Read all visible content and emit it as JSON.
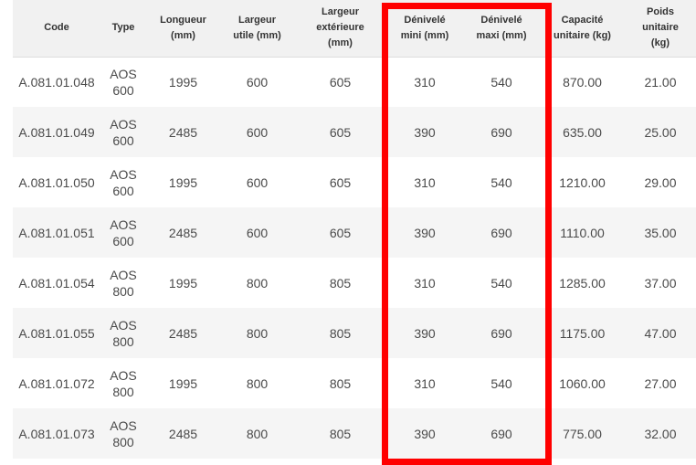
{
  "table": {
    "headers": [
      [
        "Code"
      ],
      [
        "Type"
      ],
      [
        "Longueur",
        "(mm)"
      ],
      [
        "Largeur",
        "utile (mm)"
      ],
      [
        "Largeur",
        "extérieure",
        "(mm)"
      ],
      [
        "Dénivelé",
        "mini (mm)"
      ],
      [
        "Dénivelé",
        "maxi (mm)"
      ],
      [
        "Capacité",
        "unitaire (kg)"
      ],
      [
        "Poids",
        "unitaire",
        "(kg)"
      ]
    ],
    "rows": [
      {
        "code": "A.081.01.048",
        "type": [
          "AOS",
          "600"
        ],
        "longueur": "1995",
        "largeur_utile": "600",
        "largeur_ext": "605",
        "den_mini": "310",
        "den_maxi": "540",
        "capacite": "870.00",
        "poids": "21.00"
      },
      {
        "code": "A.081.01.049",
        "type": [
          "AOS",
          "600"
        ],
        "longueur": "2485",
        "largeur_utile": "600",
        "largeur_ext": "605",
        "den_mini": "390",
        "den_maxi": "690",
        "capacite": "635.00",
        "poids": "25.00"
      },
      {
        "code": "A.081.01.050",
        "type": [
          "AOS",
          "600"
        ],
        "longueur": "1995",
        "largeur_utile": "600",
        "largeur_ext": "605",
        "den_mini": "310",
        "den_maxi": "540",
        "capacite": "1210.00",
        "poids": "29.00"
      },
      {
        "code": "A.081.01.051",
        "type": [
          "AOS",
          "600"
        ],
        "longueur": "2485",
        "largeur_utile": "600",
        "largeur_ext": "605",
        "den_mini": "390",
        "den_maxi": "690",
        "capacite": "1110.00",
        "poids": "35.00"
      },
      {
        "code": "A.081.01.054",
        "type": [
          "AOS",
          "800"
        ],
        "longueur": "1995",
        "largeur_utile": "800",
        "largeur_ext": "805",
        "den_mini": "310",
        "den_maxi": "540",
        "capacite": "1285.00",
        "poids": "37.00"
      },
      {
        "code": "A.081.01.055",
        "type": [
          "AOS",
          "800"
        ],
        "longueur": "2485",
        "largeur_utile": "800",
        "largeur_ext": "805",
        "den_mini": "390",
        "den_maxi": "690",
        "capacite": "1175.00",
        "poids": "47.00"
      },
      {
        "code": "A.081.01.072",
        "type": [
          "AOS",
          "800"
        ],
        "longueur": "1995",
        "largeur_utile": "800",
        "largeur_ext": "805",
        "den_mini": "310",
        "den_maxi": "540",
        "capacite": "1060.00",
        "poids": "27.00"
      },
      {
        "code": "A.081.01.073",
        "type": [
          "AOS",
          "800"
        ],
        "longueur": "2485",
        "largeur_utile": "800",
        "largeur_ext": "805",
        "den_mini": "390",
        "den_maxi": "690",
        "capacite": "775.00",
        "poids": "32.00"
      }
    ]
  },
  "colors": {
    "highlight_border": "#ff0000",
    "header_bg": "#f1f1f1",
    "row_alt_bg": "#f5f5f5"
  }
}
